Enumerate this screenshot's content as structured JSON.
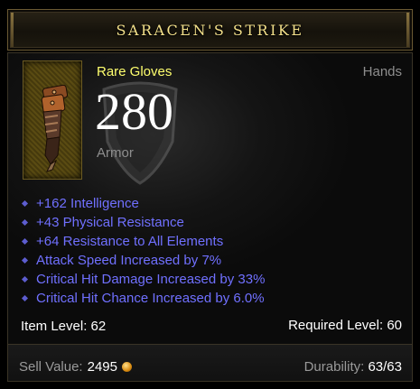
{
  "item": {
    "name": "SARACEN'S STRIKE",
    "type": "Rare Gloves",
    "slot": "Hands",
    "armor_value": "280",
    "armor_label": "Armor",
    "icon": "gloves-icon"
  },
  "affixes": [
    "+162 Intelligence",
    "+43 Physical Resistance",
    "+64 Resistance to All Elements",
    "Attack Speed Increased by 7%",
    "Critical Hit Damage Increased by 33%",
    "Critical Hit Chance Increased by 6.0%"
  ],
  "levels": {
    "item_level_label": "Item Level:",
    "item_level": "62",
    "required_level_label": "Required Level:",
    "required_level": "60"
  },
  "footer": {
    "sell_label": "Sell Value:",
    "sell_value": "2495",
    "sell_icon": "gold-coin-icon",
    "durability_label": "Durability:",
    "durability_value": "63/63"
  },
  "colors": {
    "title": "#f3e08a",
    "rare": "#ffff6e",
    "affix": "#7070ff",
    "muted": "#8e8e8e"
  }
}
